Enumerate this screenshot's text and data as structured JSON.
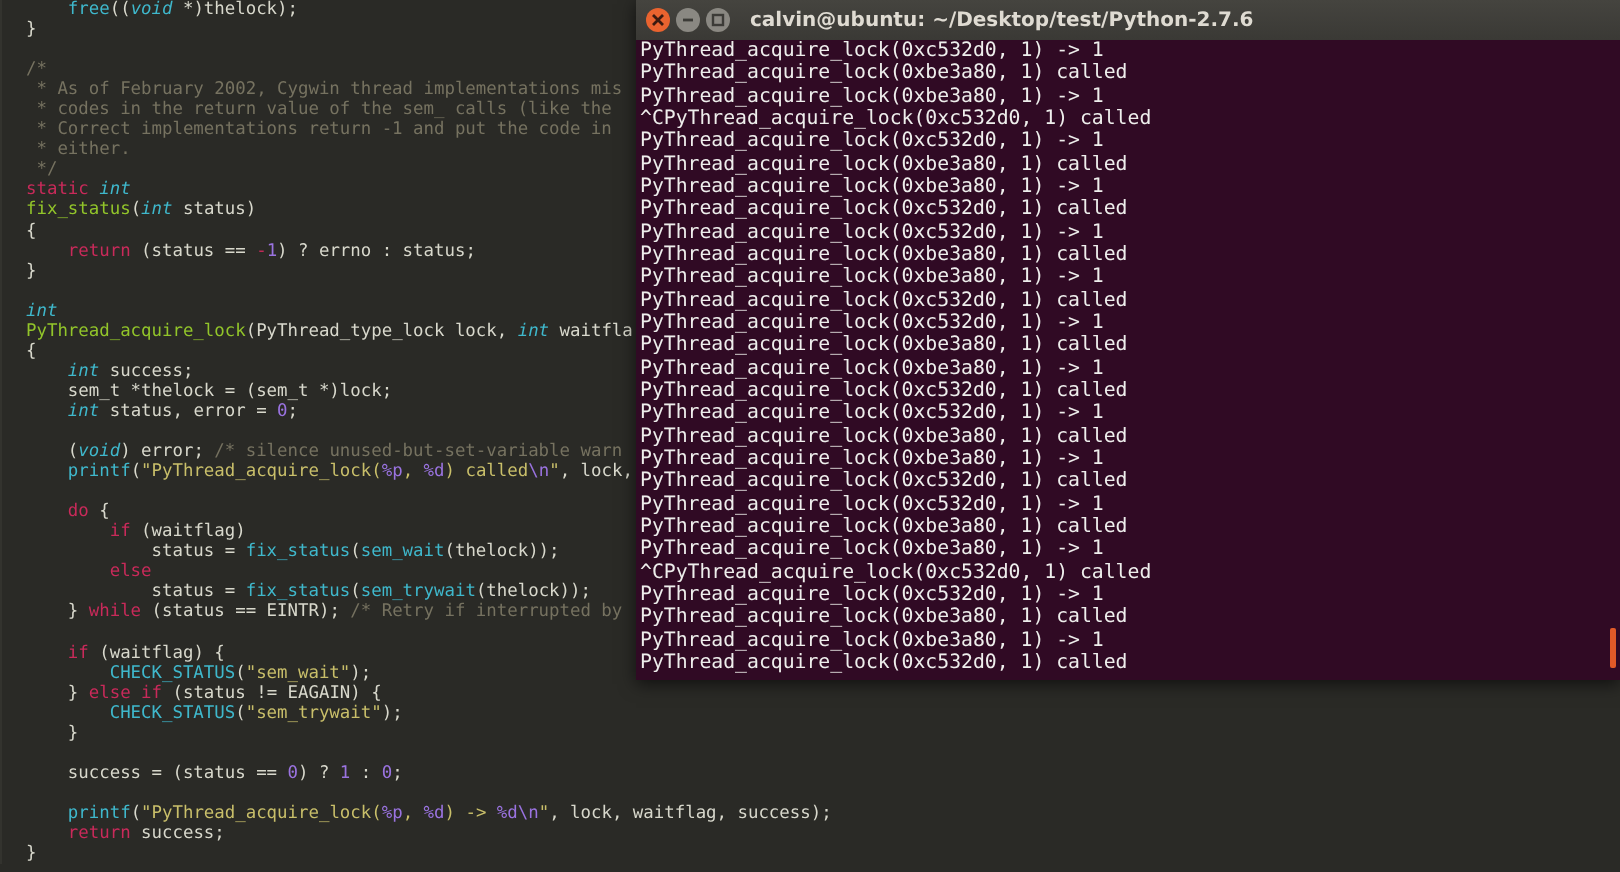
{
  "editor": {
    "lines": [
      {
        "kind": "code",
        "segments": [
          {
            "kind": "call",
            "text": "    free"
          },
          {
            "kind": "plain",
            "text": "(("
          },
          {
            "kind": "type",
            "text": "void"
          },
          {
            "kind": "plain",
            "text": " *)thelock);"
          }
        ]
      },
      {
        "kind": "code",
        "segments": [
          {
            "kind": "plain",
            "text": "}"
          }
        ]
      },
      {
        "kind": "blank"
      },
      {
        "kind": "code",
        "segments": [
          {
            "kind": "comment",
            "text": "/*"
          }
        ]
      },
      {
        "kind": "code",
        "segments": [
          {
            "kind": "comment",
            "text": " * As of February 2002, Cygwin thread implementations mis"
          }
        ]
      },
      {
        "kind": "code",
        "segments": [
          {
            "kind": "comment",
            "text": " * codes in the return value of the sem_ calls (like the"
          }
        ]
      },
      {
        "kind": "code",
        "segments": [
          {
            "kind": "comment",
            "text": " * Correct implementations return -1 and put the code in"
          }
        ]
      },
      {
        "kind": "code",
        "segments": [
          {
            "kind": "comment",
            "text": " * either."
          }
        ]
      },
      {
        "kind": "code",
        "segments": [
          {
            "kind": "comment",
            "text": " */"
          }
        ]
      },
      {
        "kind": "code",
        "segments": [
          {
            "kind": "keyword",
            "text": "static"
          },
          {
            "kind": "type",
            "text": " int"
          }
        ]
      },
      {
        "kind": "code",
        "segments": [
          {
            "kind": "func",
            "text": "fix_status"
          },
          {
            "kind": "plain",
            "text": "("
          },
          {
            "kind": "type",
            "text": "int"
          },
          {
            "kind": "plain",
            "text": " status)"
          }
        ]
      },
      {
        "kind": "code",
        "segments": [
          {
            "kind": "plain",
            "text": "{"
          }
        ]
      },
      {
        "kind": "code",
        "segments": [
          {
            "kind": "keyword",
            "text": "    return"
          },
          {
            "kind": "plain",
            "text": " (status == "
          },
          {
            "kind": "keyword",
            "text": "-"
          },
          {
            "kind": "number",
            "text": "1"
          },
          {
            "kind": "plain",
            "text": ") ? errno : status;"
          }
        ]
      },
      {
        "kind": "code",
        "segments": [
          {
            "kind": "plain",
            "text": "}"
          }
        ]
      },
      {
        "kind": "blank"
      },
      {
        "kind": "code",
        "segments": [
          {
            "kind": "type",
            "text": "int"
          }
        ]
      },
      {
        "kind": "code",
        "segments": [
          {
            "kind": "func",
            "text": "PyThread_acquire_lock"
          },
          {
            "kind": "plain",
            "text": "(PyThread_type_lock lock, "
          },
          {
            "kind": "type",
            "text": "int"
          },
          {
            "kind": "plain",
            "text": " waitfla"
          }
        ]
      },
      {
        "kind": "code",
        "segments": [
          {
            "kind": "plain",
            "text": "{"
          }
        ]
      },
      {
        "kind": "code",
        "segments": [
          {
            "kind": "type",
            "text": "    int"
          },
          {
            "kind": "plain",
            "text": " success;"
          }
        ]
      },
      {
        "kind": "code",
        "segments": [
          {
            "kind": "plain",
            "text": "    sem_t *thelock = (sem_t *)lock;"
          }
        ]
      },
      {
        "kind": "code",
        "segments": [
          {
            "kind": "type",
            "text": "    int"
          },
          {
            "kind": "plain",
            "text": " status, error = "
          },
          {
            "kind": "number",
            "text": "0"
          },
          {
            "kind": "plain",
            "text": ";"
          }
        ]
      },
      {
        "kind": "blank"
      },
      {
        "kind": "code",
        "segments": [
          {
            "kind": "plain",
            "text": "    ("
          },
          {
            "kind": "type",
            "text": "void"
          },
          {
            "kind": "plain",
            "text": ") error; "
          },
          {
            "kind": "comment",
            "text": "/* silence unused-but-set-variable warn"
          }
        ]
      },
      {
        "kind": "code",
        "segments": [
          {
            "kind": "call",
            "text": "    printf"
          },
          {
            "kind": "plain",
            "text": "("
          },
          {
            "kind": "string",
            "text": "\"PyThread_acquire_lock("
          },
          {
            "kind": "format",
            "text": "%p"
          },
          {
            "kind": "string",
            "text": ", "
          },
          {
            "kind": "format",
            "text": "%d"
          },
          {
            "kind": "string",
            "text": ") called"
          },
          {
            "kind": "format",
            "text": "\\n"
          },
          {
            "kind": "string",
            "text": "\""
          },
          {
            "kind": "plain",
            "text": ", lock,"
          }
        ]
      },
      {
        "kind": "blank"
      },
      {
        "kind": "code",
        "segments": [
          {
            "kind": "keyword",
            "text": "    do"
          },
          {
            "kind": "plain",
            "text": " {"
          }
        ]
      },
      {
        "kind": "code",
        "segments": [
          {
            "kind": "keyword",
            "text": "        if"
          },
          {
            "kind": "plain",
            "text": " (waitflag)"
          }
        ]
      },
      {
        "kind": "code",
        "segments": [
          {
            "kind": "plain",
            "text": "            status = "
          },
          {
            "kind": "call",
            "text": "fix_status"
          },
          {
            "kind": "plain",
            "text": "("
          },
          {
            "kind": "call",
            "text": "sem_wait"
          },
          {
            "kind": "plain",
            "text": "(thelock));"
          }
        ]
      },
      {
        "kind": "code",
        "segments": [
          {
            "kind": "keyword",
            "text": "        else"
          }
        ]
      },
      {
        "kind": "code",
        "segments": [
          {
            "kind": "plain",
            "text": "            status = "
          },
          {
            "kind": "call",
            "text": "fix_status"
          },
          {
            "kind": "plain",
            "text": "("
          },
          {
            "kind": "call",
            "text": "sem_trywait"
          },
          {
            "kind": "plain",
            "text": "(thelock));"
          }
        ]
      },
      {
        "kind": "code",
        "segments": [
          {
            "kind": "plain",
            "text": "    } "
          },
          {
            "kind": "keyword",
            "text": "while"
          },
          {
            "kind": "plain",
            "text": " (status == EINTR); "
          },
          {
            "kind": "comment",
            "text": "/* Retry if interrupted by"
          }
        ]
      },
      {
        "kind": "blank"
      },
      {
        "kind": "code",
        "segments": [
          {
            "kind": "keyword",
            "text": "    if"
          },
          {
            "kind": "plain",
            "text": " (waitflag) {"
          }
        ]
      },
      {
        "kind": "code",
        "segments": [
          {
            "kind": "call",
            "text": "        CHECK_STATUS"
          },
          {
            "kind": "plain",
            "text": "("
          },
          {
            "kind": "string",
            "text": "\"sem_wait\""
          },
          {
            "kind": "plain",
            "text": ");"
          }
        ]
      },
      {
        "kind": "code",
        "segments": [
          {
            "kind": "plain",
            "text": "    } "
          },
          {
            "kind": "keyword",
            "text": "else if"
          },
          {
            "kind": "plain",
            "text": " (status != EAGAIN) {"
          }
        ]
      },
      {
        "kind": "code",
        "segments": [
          {
            "kind": "call",
            "text": "        CHECK_STATUS"
          },
          {
            "kind": "plain",
            "text": "("
          },
          {
            "kind": "string",
            "text": "\"sem_trywait\""
          },
          {
            "kind": "plain",
            "text": ");"
          }
        ]
      },
      {
        "kind": "code",
        "segments": [
          {
            "kind": "plain",
            "text": "    }"
          }
        ]
      },
      {
        "kind": "blank"
      },
      {
        "kind": "code",
        "segments": [
          {
            "kind": "plain",
            "text": "    success = (status == "
          },
          {
            "kind": "number",
            "text": "0"
          },
          {
            "kind": "plain",
            "text": ") ? "
          },
          {
            "kind": "number",
            "text": "1"
          },
          {
            "kind": "plain",
            "text": " : "
          },
          {
            "kind": "number",
            "text": "0"
          },
          {
            "kind": "plain",
            "text": ";"
          }
        ]
      },
      {
        "kind": "blank"
      },
      {
        "kind": "code",
        "segments": [
          {
            "kind": "call",
            "text": "    printf"
          },
          {
            "kind": "plain",
            "text": "("
          },
          {
            "kind": "string",
            "text": "\"PyThread_acquire_lock("
          },
          {
            "kind": "format",
            "text": "%p"
          },
          {
            "kind": "string",
            "text": ", "
          },
          {
            "kind": "format",
            "text": "%d"
          },
          {
            "kind": "string",
            "text": ") -> "
          },
          {
            "kind": "format",
            "text": "%d"
          },
          {
            "kind": "format",
            "text": "\\n"
          },
          {
            "kind": "string",
            "text": "\""
          },
          {
            "kind": "plain",
            "text": ", lock, waitflag, success);"
          }
        ]
      },
      {
        "kind": "code",
        "segments": [
          {
            "kind": "keyword",
            "text": "    return"
          },
          {
            "kind": "plain",
            "text": " success;"
          }
        ]
      },
      {
        "kind": "code",
        "segments": [
          {
            "kind": "plain",
            "text": "}"
          }
        ]
      }
    ]
  },
  "terminal": {
    "title": "calvin@ubuntu: ~/Desktop/test/Python-2.7.6",
    "lines": [
      "PyThread_acquire_lock(0xc532d0, 1) -> 1",
      "PyThread_acquire_lock(0xbe3a80, 1) called",
      "PyThread_acquire_lock(0xbe3a80, 1) -> 1",
      "^CPyThread_acquire_lock(0xc532d0, 1) called",
      "PyThread_acquire_lock(0xc532d0, 1) -> 1",
      "PyThread_acquire_lock(0xbe3a80, 1) called",
      "PyThread_acquire_lock(0xbe3a80, 1) -> 1",
      "PyThread_acquire_lock(0xc532d0, 1) called",
      "PyThread_acquire_lock(0xc532d0, 1) -> 1",
      "PyThread_acquire_lock(0xbe3a80, 1) called",
      "PyThread_acquire_lock(0xbe3a80, 1) -> 1",
      "PyThread_acquire_lock(0xc532d0, 1) called",
      "PyThread_acquire_lock(0xc532d0, 1) -> 1",
      "PyThread_acquire_lock(0xbe3a80, 1) called",
      "PyThread_acquire_lock(0xbe3a80, 1) -> 1",
      "PyThread_acquire_lock(0xc532d0, 1) called",
      "PyThread_acquire_lock(0xc532d0, 1) -> 1",
      "PyThread_acquire_lock(0xbe3a80, 1) called",
      "PyThread_acquire_lock(0xbe3a80, 1) -> 1",
      "PyThread_acquire_lock(0xc532d0, 1) called",
      "PyThread_acquire_lock(0xc532d0, 1) -> 1",
      "PyThread_acquire_lock(0xbe3a80, 1) called",
      "PyThread_acquire_lock(0xbe3a80, 1) -> 1",
      "^CPyThread_acquire_lock(0xc532d0, 1) called",
      "PyThread_acquire_lock(0xc532d0, 1) -> 1",
      "PyThread_acquire_lock(0xbe3a80, 1) called",
      "PyThread_acquire_lock(0xbe3a80, 1) -> 1",
      "PyThread_acquire_lock(0xc532d0, 1) called"
    ]
  }
}
